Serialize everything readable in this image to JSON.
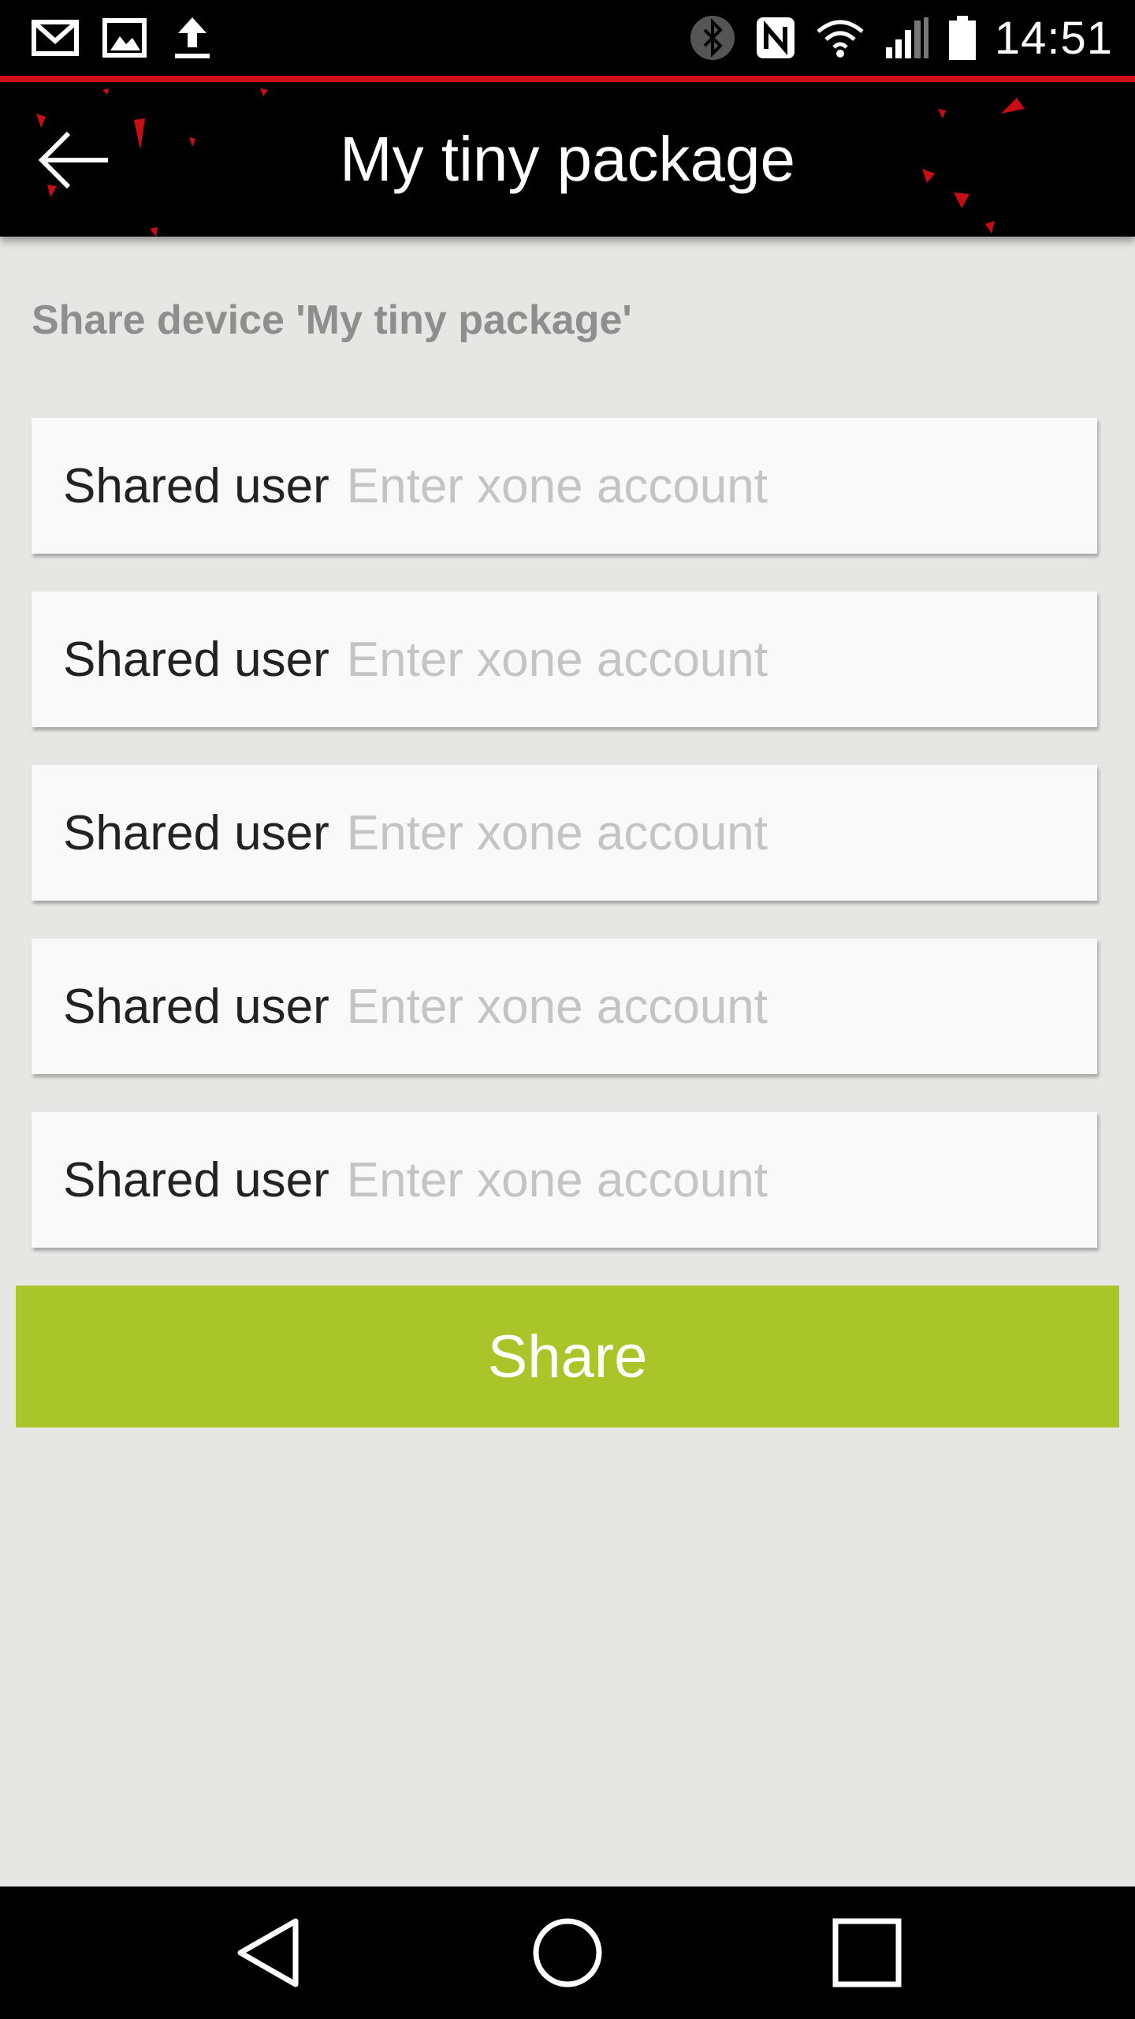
{
  "status_bar": {
    "time": "14:51",
    "left_icons": [
      "gmail-icon",
      "gallery-icon",
      "upload-icon"
    ],
    "right_icons": [
      "bluetooth-icon",
      "nfc-icon",
      "wifi-icon",
      "signal-icon",
      "battery-icon"
    ]
  },
  "app_bar": {
    "title": "My tiny package",
    "back_icon": "arrow-back-icon"
  },
  "main": {
    "heading": "Share device 'My tiny package'",
    "fields": [
      {
        "label": "Shared user",
        "value": "",
        "placeholder": "Enter xone account"
      },
      {
        "label": "Shared user",
        "value": "",
        "placeholder": "Enter xone account"
      },
      {
        "label": "Shared user",
        "value": "",
        "placeholder": "Enter xone account"
      },
      {
        "label": "Shared user",
        "value": "",
        "placeholder": "Enter xone account"
      },
      {
        "label": "Shared user",
        "value": "",
        "placeholder": "Enter xone account"
      }
    ],
    "share_label": "Share"
  },
  "nav_bar": {
    "icons": [
      "back-triangle-icon",
      "home-circle-icon",
      "recents-square-icon"
    ]
  },
  "colors": {
    "accent_red": "#d0111b",
    "share_button": "#a9c52a",
    "background": "#e6e6e5",
    "card": "#f9f9f9"
  }
}
